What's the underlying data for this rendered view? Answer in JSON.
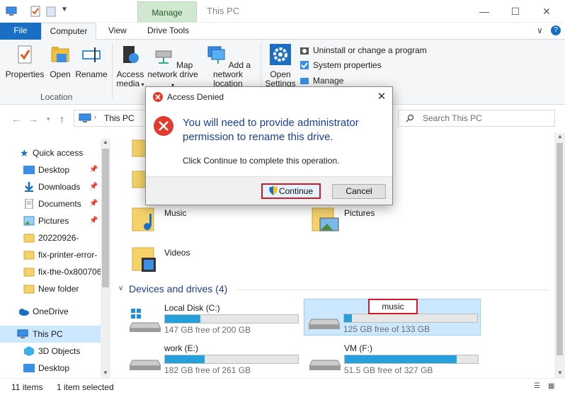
{
  "window": {
    "title": "This PC",
    "context_tab": "Manage",
    "minimize": "—",
    "maximize": "☐",
    "close": "✕"
  },
  "ribbon_tabs": [
    "File",
    "Computer",
    "View",
    "Drive Tools"
  ],
  "ribbon_right": {
    "collapse": "∨",
    "help": "?"
  },
  "ribbon": {
    "properties": "Properties",
    "open": "Open",
    "rename": "Rename",
    "location_group": "Location",
    "access_media": "Access media",
    "map_network_drive": "Map network drive",
    "add_network_location": "Add a network location",
    "open_settings": "Open Settings",
    "uninstall": "Uninstall or change a program",
    "system_properties": "System properties",
    "manage": "Manage"
  },
  "address": {
    "path": "This PC",
    "search_placeholder": "Search This PC"
  },
  "nav": {
    "quick_access": "Quick access",
    "items": [
      {
        "label": "Desktop",
        "pinned": true
      },
      {
        "label": "Downloads",
        "pinned": true
      },
      {
        "label": "Documents",
        "pinned": true
      },
      {
        "label": "Pictures",
        "pinned": true
      },
      {
        "label": "20220926-",
        "pinned": false
      },
      {
        "label": "fix-printer-error-",
        "pinned": false
      },
      {
        "label": "fix-the-0x800706",
        "pinned": false
      },
      {
        "label": "New folder",
        "pinned": false
      }
    ],
    "onedrive": "OneDrive",
    "this_pc": "This PC",
    "objects_3d": "3D Objects",
    "desktop2": "Desktop"
  },
  "folders": {
    "music": "Music",
    "pictures": "Pictures",
    "videos": "Videos"
  },
  "devices": {
    "title": "Devices and drives (4)",
    "drives": [
      {
        "name": "Local Disk (C:)",
        "free": "147 GB free of 200 GB",
        "used_fraction": 0.265
      },
      {
        "name": "music",
        "free": "125 GB free of 133 GB",
        "used_fraction": 0.06
      },
      {
        "name": "work (E:)",
        "free": "182 GB free of 261 GB",
        "used_fraction": 0.3
      },
      {
        "name": "VM (F:)",
        "free": "51.5 GB free of 327 GB",
        "used_fraction": 0.84
      }
    ]
  },
  "status": {
    "count": "11 items",
    "selected": "1 item selected"
  },
  "dialog": {
    "title": "Access Denied",
    "close": "✕",
    "message": "You will need to provide administrator permission to rename this drive.",
    "sub": "Click Continue to complete this operation.",
    "continue": "Continue",
    "cancel": "Cancel"
  },
  "colors": {
    "accent": "#1a6fc4",
    "drive_fill": "#26a0da",
    "highlight_red": "#d11a2a",
    "dialog_message": "#1a3f9a"
  }
}
